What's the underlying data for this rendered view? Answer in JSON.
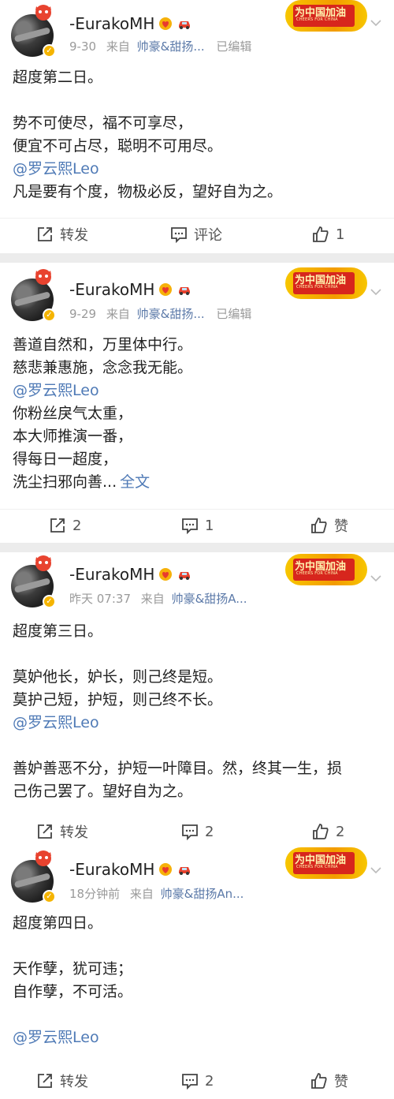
{
  "posts": [
    {
      "username": "-EurakoMH",
      "time": "9-30",
      "source_prefix": "来自",
      "source": "帅豪&甜扬...",
      "edited": "已编辑",
      "banner_title": "为中国加油",
      "banner_sub": "CHEERS FOR CHINA",
      "lines": [
        "超度第二日。",
        "",
        "势不可使尽，福不可享尽，",
        "便宜不可占尽，聪明不可用尽。"
      ],
      "mention": "@罗云熙Leo",
      "lines_after": [
        "凡是要有个度，物极必反，望好自为之。"
      ],
      "repost": "转发",
      "comment": "评论",
      "like": "1"
    },
    {
      "username": "-EurakoMH",
      "time": "9-29",
      "source_prefix": "来自",
      "source": "帅豪&甜扬...",
      "edited": "已编辑",
      "banner_title": "为中国加油",
      "banner_sub": "CHEERS FOR CHINA",
      "lines": [
        "善道自然和，万里体中行。",
        "慈悲兼惠施，念念我无能。"
      ],
      "mention": "@罗云熙Leo",
      "lines_after": [
        "你粉丝戾气太重，",
        "本大师推演一番，",
        "得每日一超度，"
      ],
      "last_line": "洗尘扫邪向善...",
      "full_text": "全文",
      "repost": "2",
      "comment": "1",
      "like": "赞"
    },
    {
      "username": "-EurakoMH",
      "time": "昨天 07:37",
      "source_prefix": "来自",
      "source": "帅豪&甜扬A...",
      "banner_title": "为中国加油",
      "banner_sub": "CHEERS FOR CHINA",
      "lines": [
        "超度第三日。",
        "",
        "莫妒他长，妒长，则己终是短。",
        "莫护己短，护短，则己终不长。"
      ],
      "mention": "@罗云熙Leo",
      "lines_after": [
        "",
        "善妒善恶不分，护短一叶障目。然，终其一生，损",
        "己伤己罢了。望好自为之。"
      ],
      "repost": "转发",
      "comment": "2",
      "like": "2"
    },
    {
      "username": "-EurakoMH",
      "time": "18分钟前",
      "source_prefix": "来自",
      "source": "帅豪&甜扬An...",
      "banner_title": "为中国加油",
      "banner_sub": "CHEERS FOR CHINA",
      "lines": [
        "超度第四日。",
        "",
        "天作孽，犹可违；",
        "自作孽，不可活。",
        ""
      ],
      "mention": "@罗云熙Leo",
      "lines_after": [],
      "repost": "转发",
      "comment": "2",
      "like": "赞"
    }
  ],
  "colors": {
    "link": "#4f7ab6",
    "source": "#5b79a8",
    "meta": "#9a9a9a",
    "verified": "#f5b400",
    "banner": "#d7261d"
  },
  "icons": [
    "repost-icon",
    "comment-icon",
    "like-icon",
    "chevron-down-icon",
    "verified-icon",
    "heart-badge-icon",
    "car-badge-icon"
  ]
}
